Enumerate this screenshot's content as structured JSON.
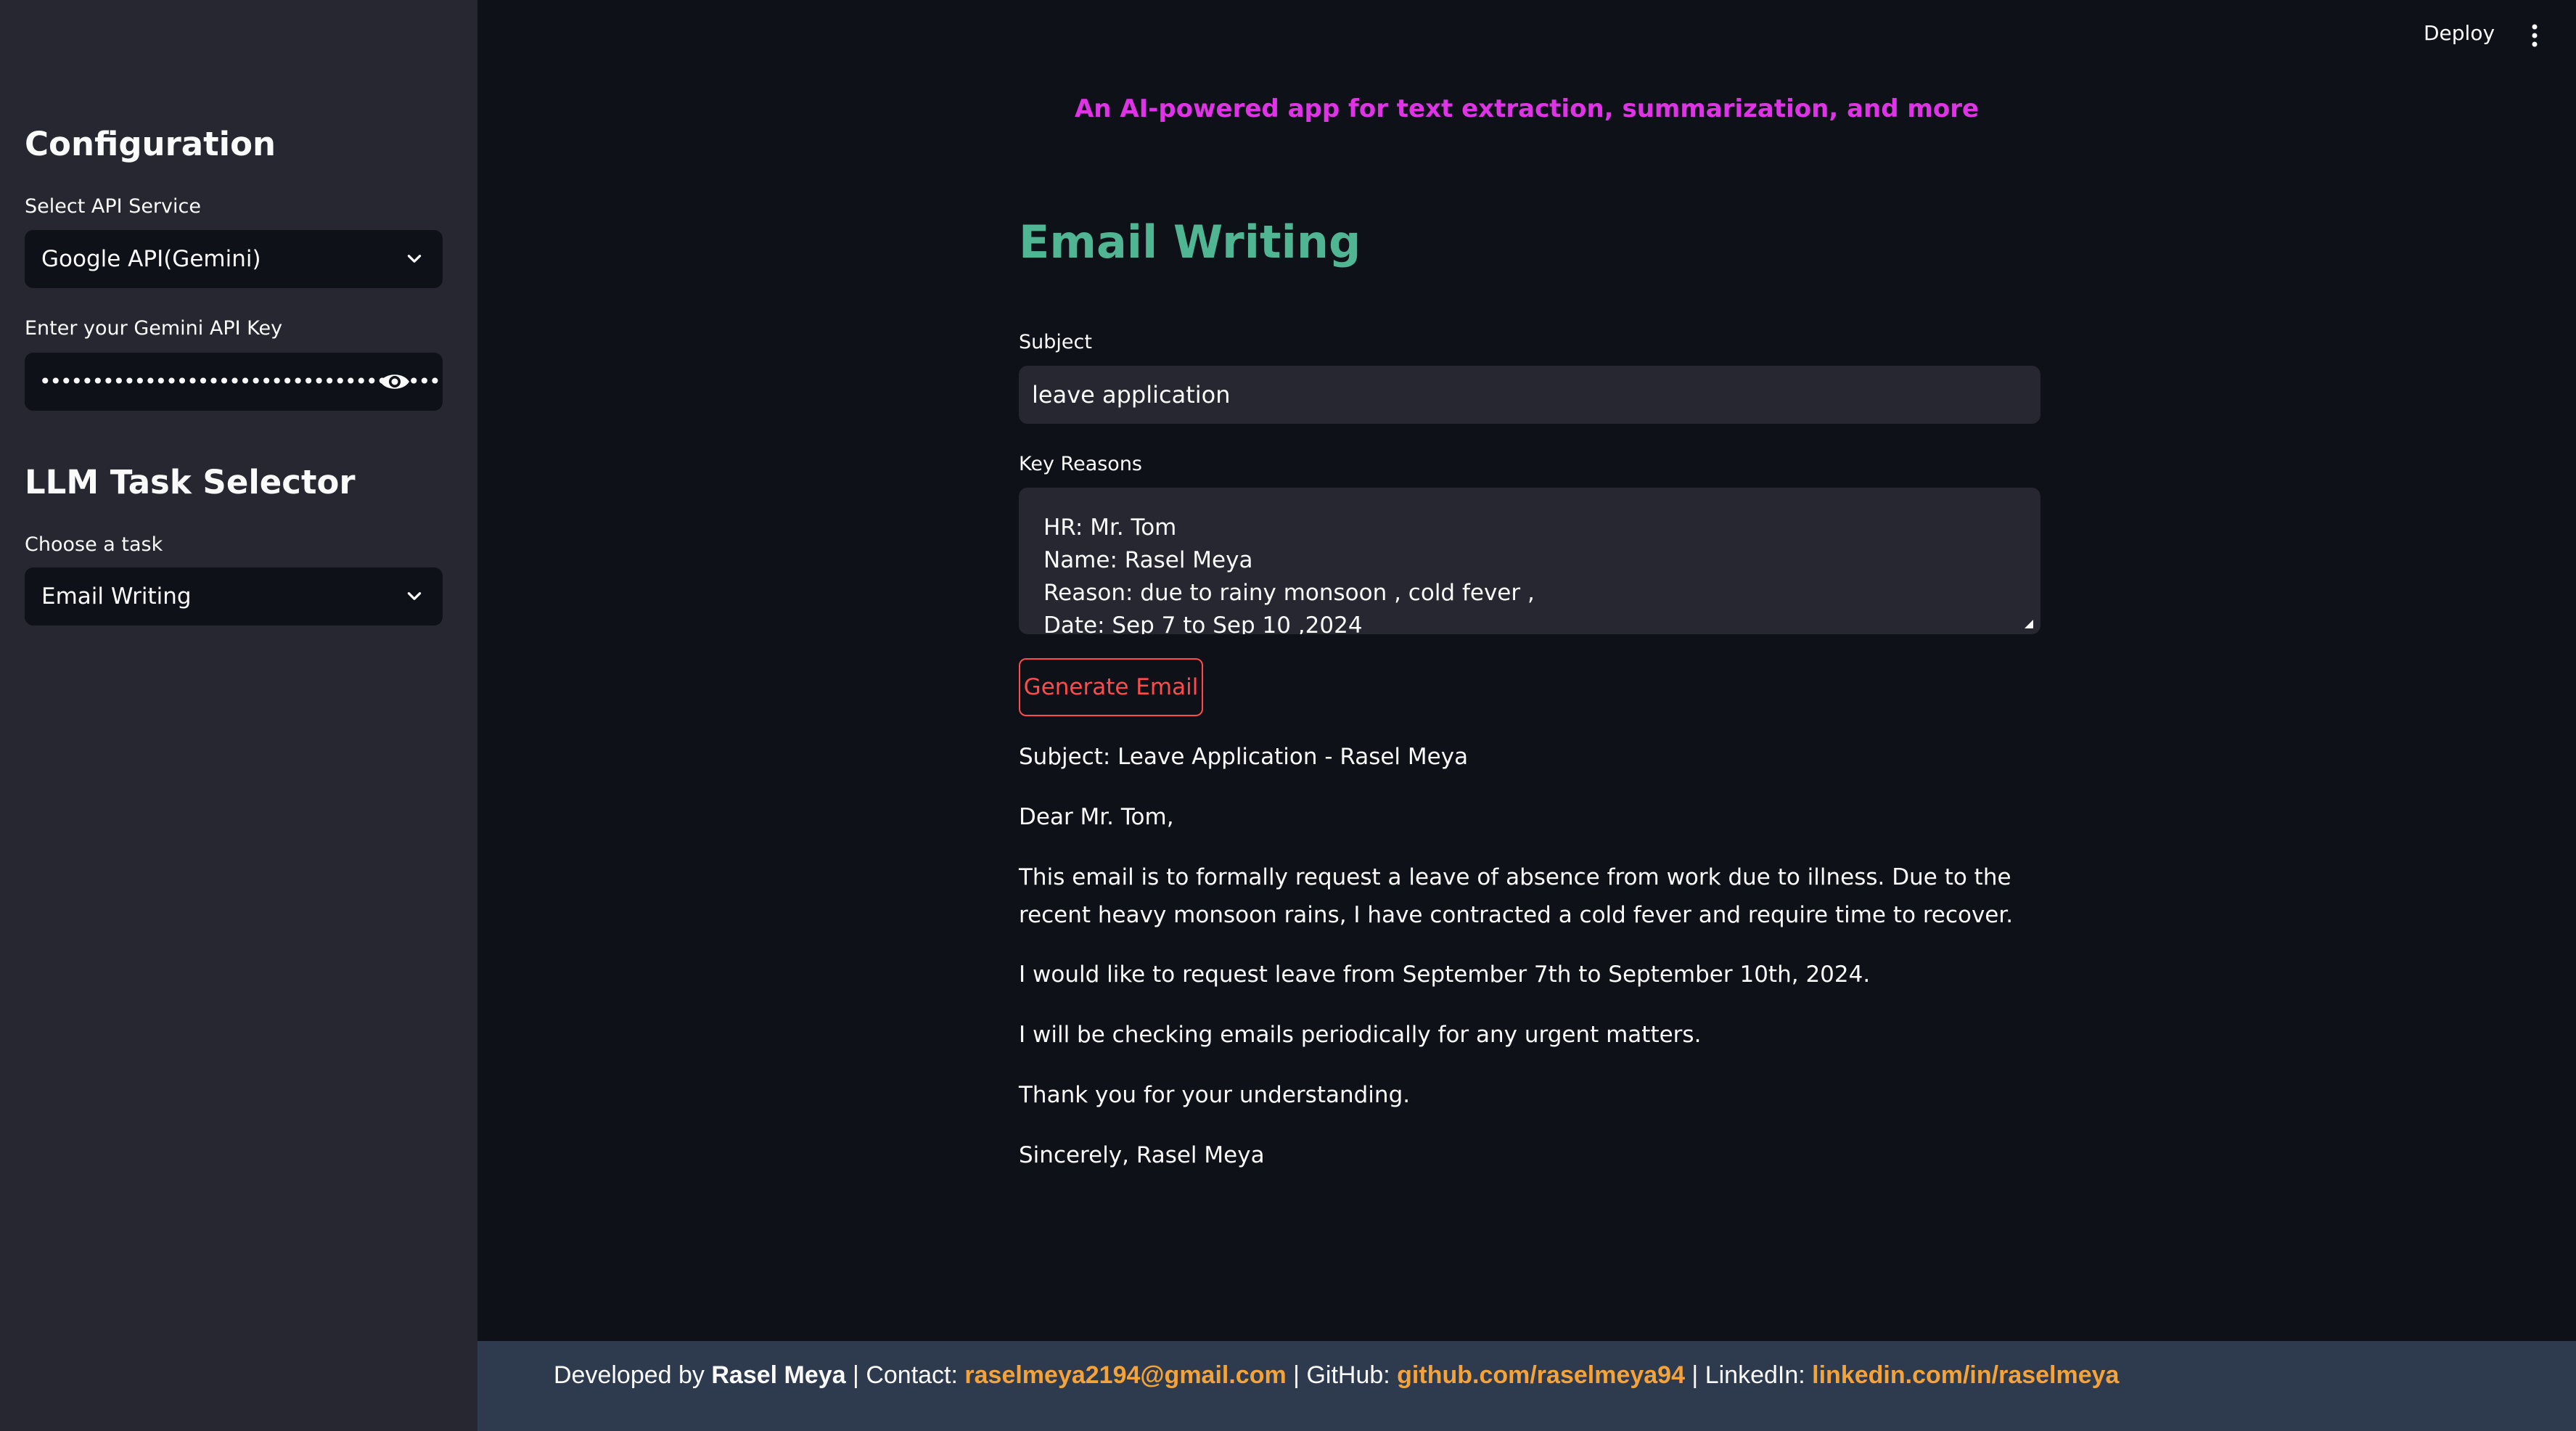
{
  "header": {
    "deploy_label": "Deploy",
    "menu_icon": "vertical-dots-icon",
    "tagline": "An AI-powered app for text extraction, summarization, and more",
    "tagline_color": "#e033e7"
  },
  "sidebar": {
    "config_heading": "Configuration",
    "api_service_label": "Select API Service",
    "api_service_value": "Google API(Gemini)",
    "api_key_label": "Enter your Gemini API Key",
    "api_key_masked": "••••••••••••••••••••••••••••••••••••••",
    "task_heading": "LLM Task Selector",
    "task_label": "Choose a task",
    "task_value": "Email Writing"
  },
  "main": {
    "title": "Email Writing",
    "title_color": "#4fb592",
    "subject_label": "Subject",
    "subject_value": "leave application",
    "reasons_label": "Key Reasons",
    "reasons_lines": [
      "HR:  Mr. Tom",
      "Name: Rasel Meya",
      "Reason: due to rainy monsoon , cold fever ,",
      "Date: Sep 7 to Sep 10 ,2024"
    ],
    "generate_button": "Generate Email",
    "accent_color": "#ff4b4b",
    "email": {
      "subject": "Subject: Leave Application - Rasel Meya",
      "greeting": "Dear Mr. Tom,",
      "para1": "This email is to formally request a leave of absence from work due to illness. Due to the recent heavy monsoon rains, I have contracted a cold fever and require time to recover.",
      "para2": "I would like to request leave from September 7th to September 10th, 2024.",
      "para3": "I will be checking emails periodically for any urgent matters.",
      "para4": "Thank you for your understanding.",
      "closing": "Sincerely, Rasel Meya"
    }
  },
  "footer": {
    "developed_by": "Developed by ",
    "developer_name": "Rasel Meya",
    "contact_label": " | Contact: ",
    "email": "raselmeya2194@gmail.com",
    "github_label": " | GitHub: ",
    "github": "github.com/raselmeya94",
    "linkedin_label": " | LinkedIn: ",
    "linkedin": "linkedin.com/in/raselmeya",
    "link_color": "#f3a33a"
  }
}
